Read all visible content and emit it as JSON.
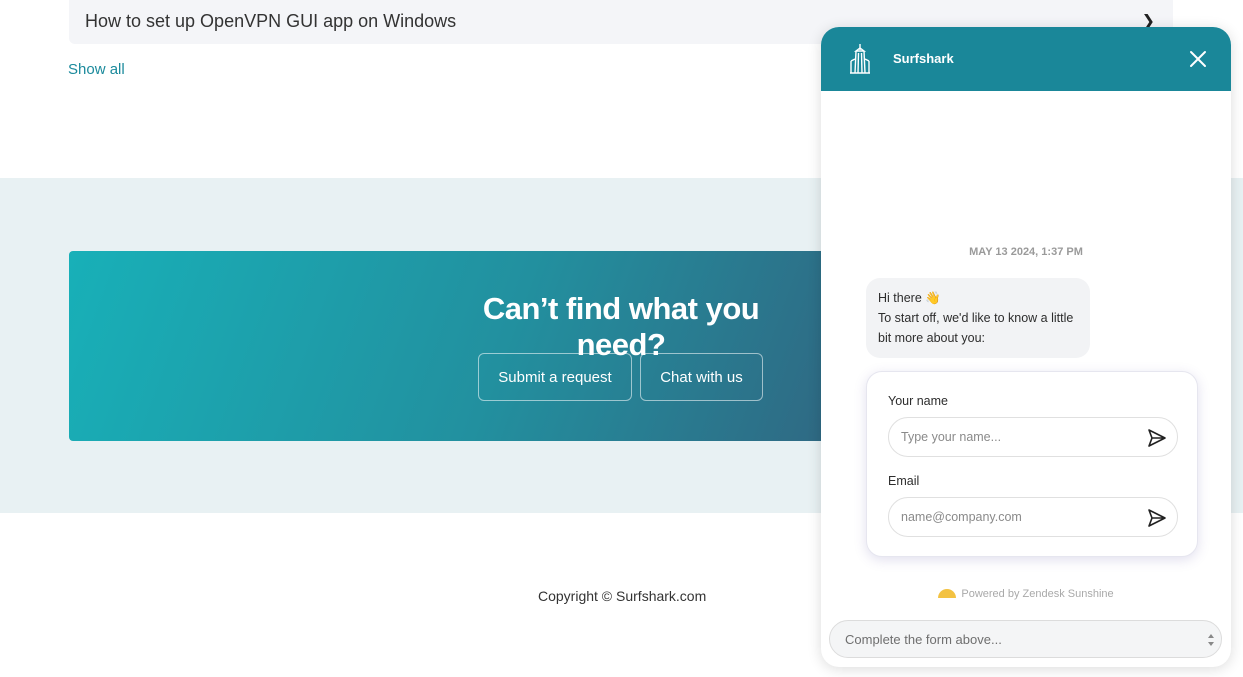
{
  "articles": {
    "last_item": "How to set up OpenVPN GUI app on Windows",
    "show_all": "Show all"
  },
  "banner": {
    "heading": "Can’t find what you need?",
    "submit_label": "Submit a request",
    "chat_label": "Chat with us"
  },
  "footer": {
    "copyright": "Copyright © Surfshark.com"
  },
  "chat_widget": {
    "title": "Surfshark",
    "header_color": "#1a8799",
    "timestamp": "MAY 13 2024, 1:37 PM",
    "greeting_line1": "Hi there 👋",
    "greeting_line2": "To start off, we'd like to know a little bit more about you:",
    "form": {
      "name_label": "Your name",
      "name_placeholder": "Type your name...",
      "email_label": "Email",
      "email_placeholder": "name@company.com"
    },
    "powered_by": "Powered by Zendesk Sunshine",
    "composer_placeholder": "Complete the form above..."
  }
}
